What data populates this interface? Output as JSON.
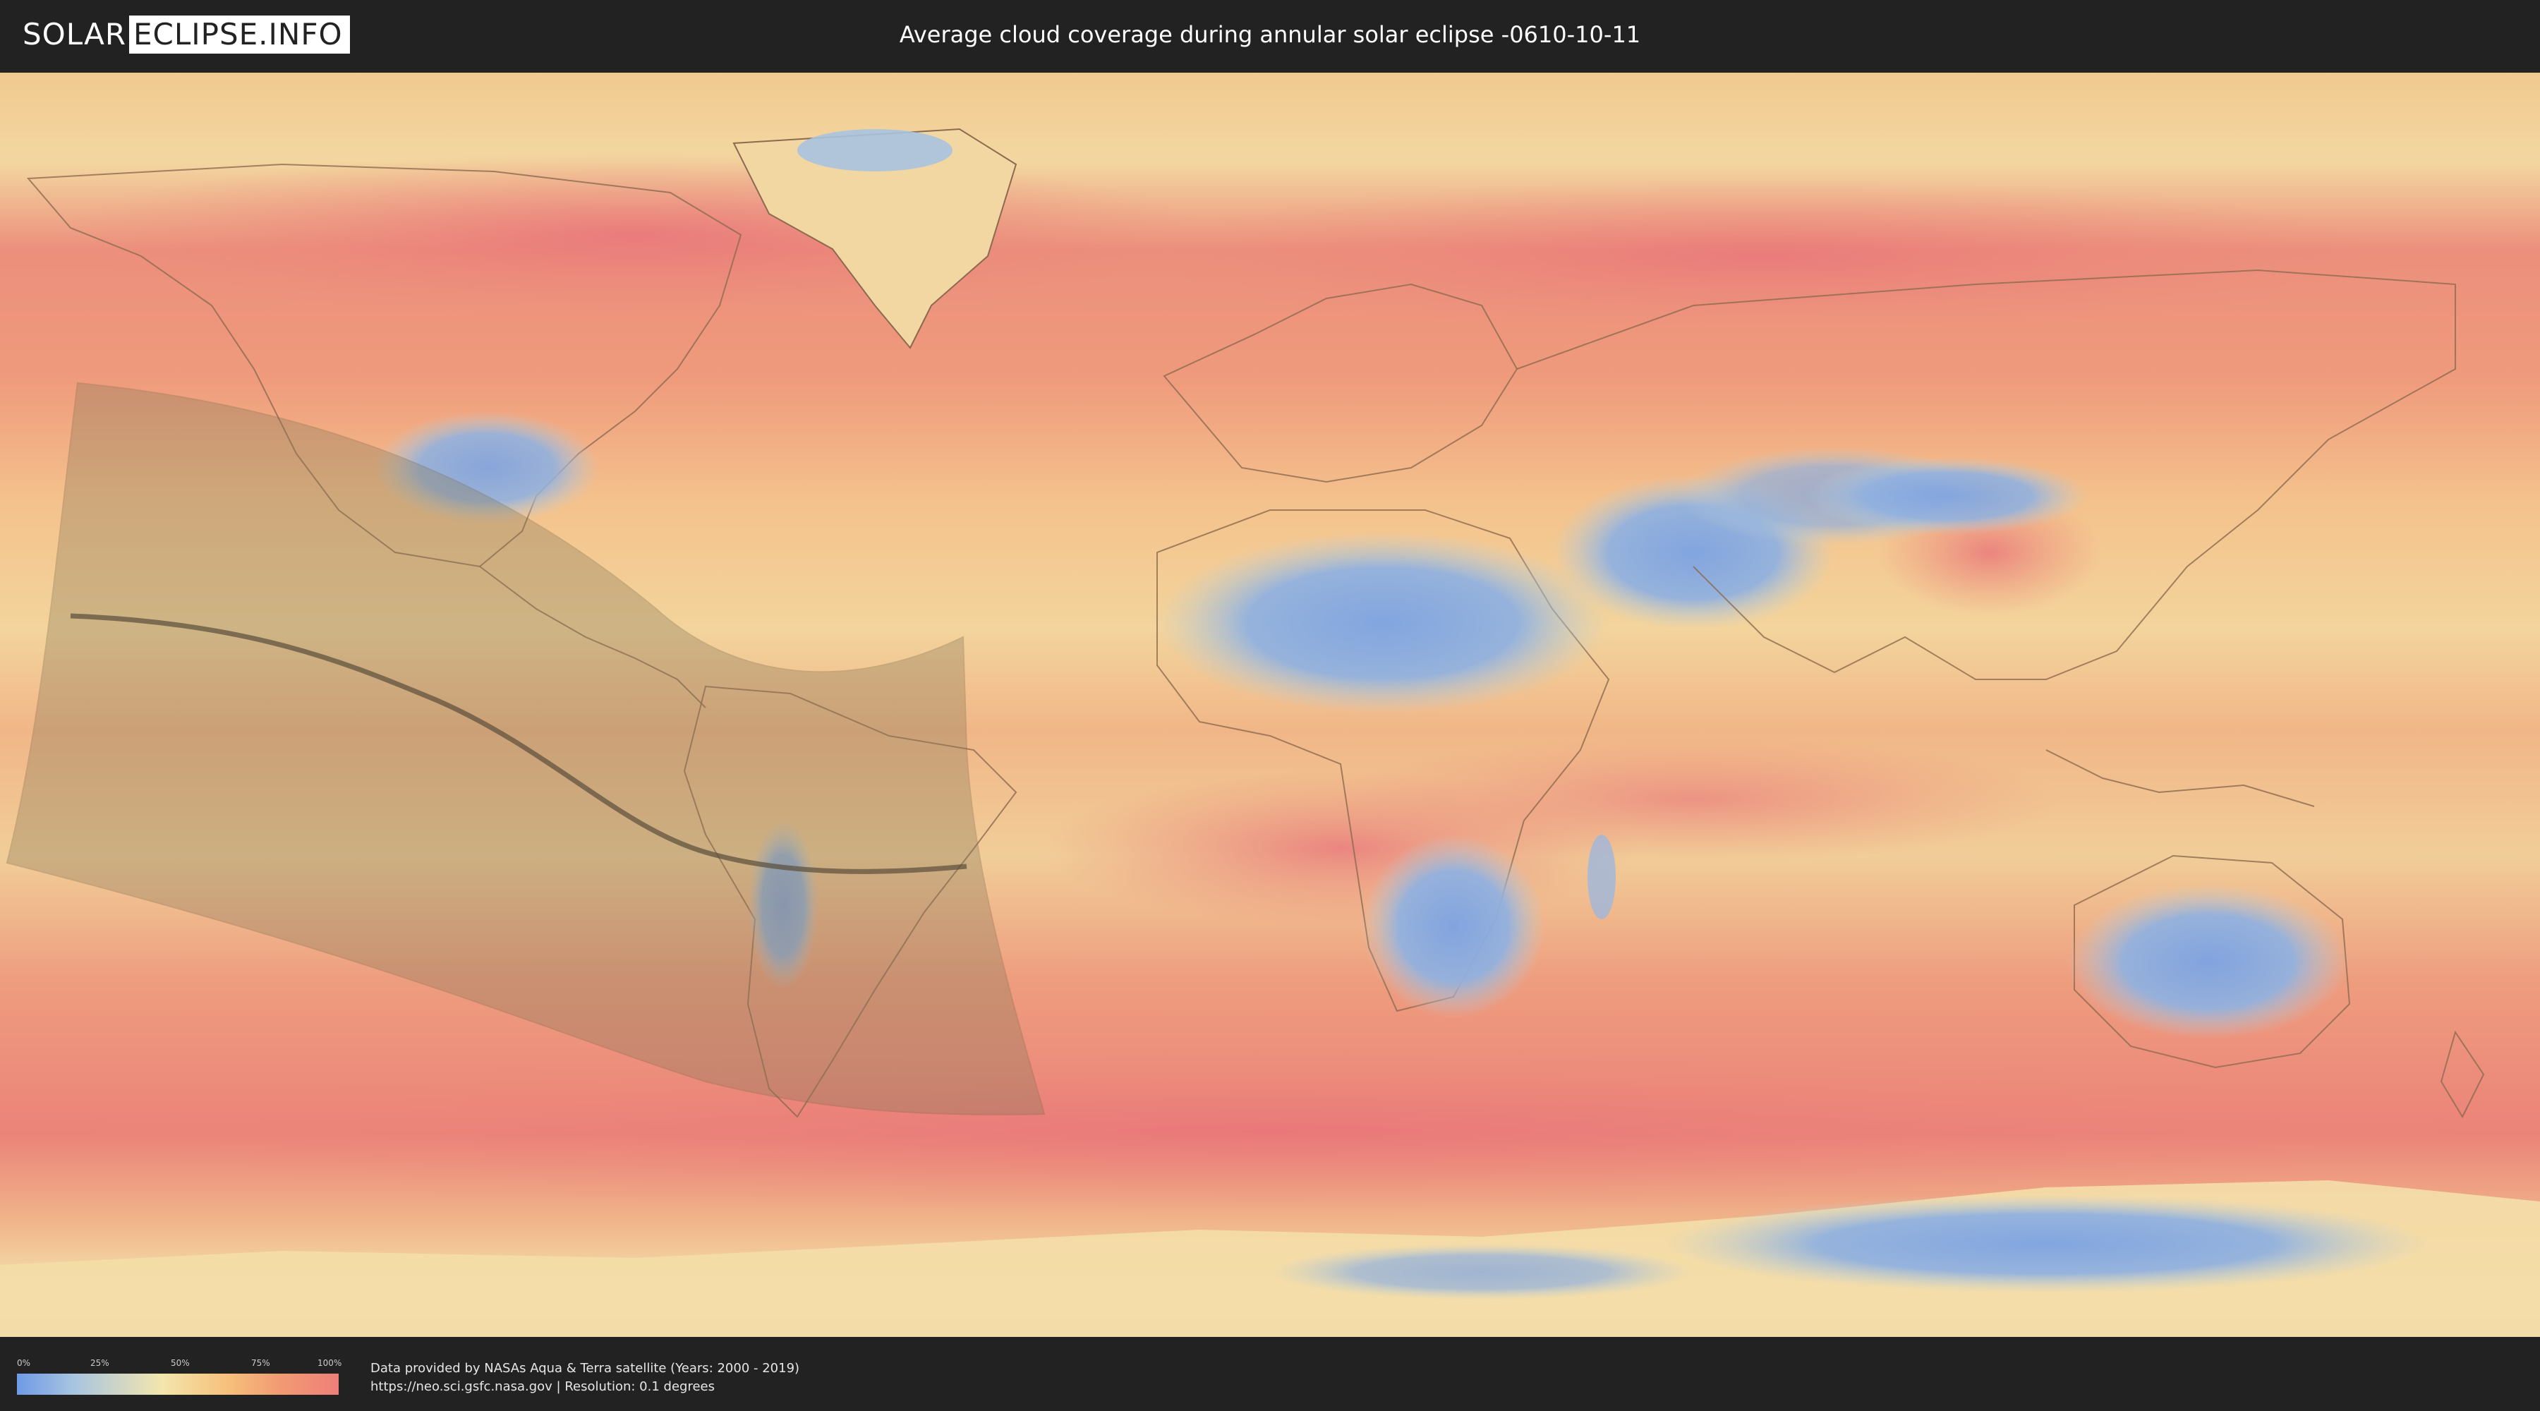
{
  "header": {
    "logo_left": "SOLAR",
    "logo_right": "ECLIPSE.INFO",
    "title": "Average cloud coverage during annular solar eclipse -0610-10-11"
  },
  "legend": {
    "ticks": [
      "0%",
      "25%",
      "50%",
      "75%",
      "100%"
    ],
    "colors": [
      "#6f9ae6",
      "#f3e6ad",
      "#ee7f78"
    ]
  },
  "footer": {
    "credit_line1": "Data provided by NASAs Aqua & Terra satellite (Years: 2000 - 2019)",
    "credit_line2": "https://neo.sci.gsfc.nasa.gov | Resolution: 0.1 degrees"
  },
  "map": {
    "projection": "equirectangular world map",
    "colors": {
      "clear": "#7ea4e2",
      "mid": "#f2dfa6",
      "cloudy": "#ec8a7b",
      "eclipse_zone": "#8a7a5a",
      "central_line": "#5a4d3a"
    }
  }
}
